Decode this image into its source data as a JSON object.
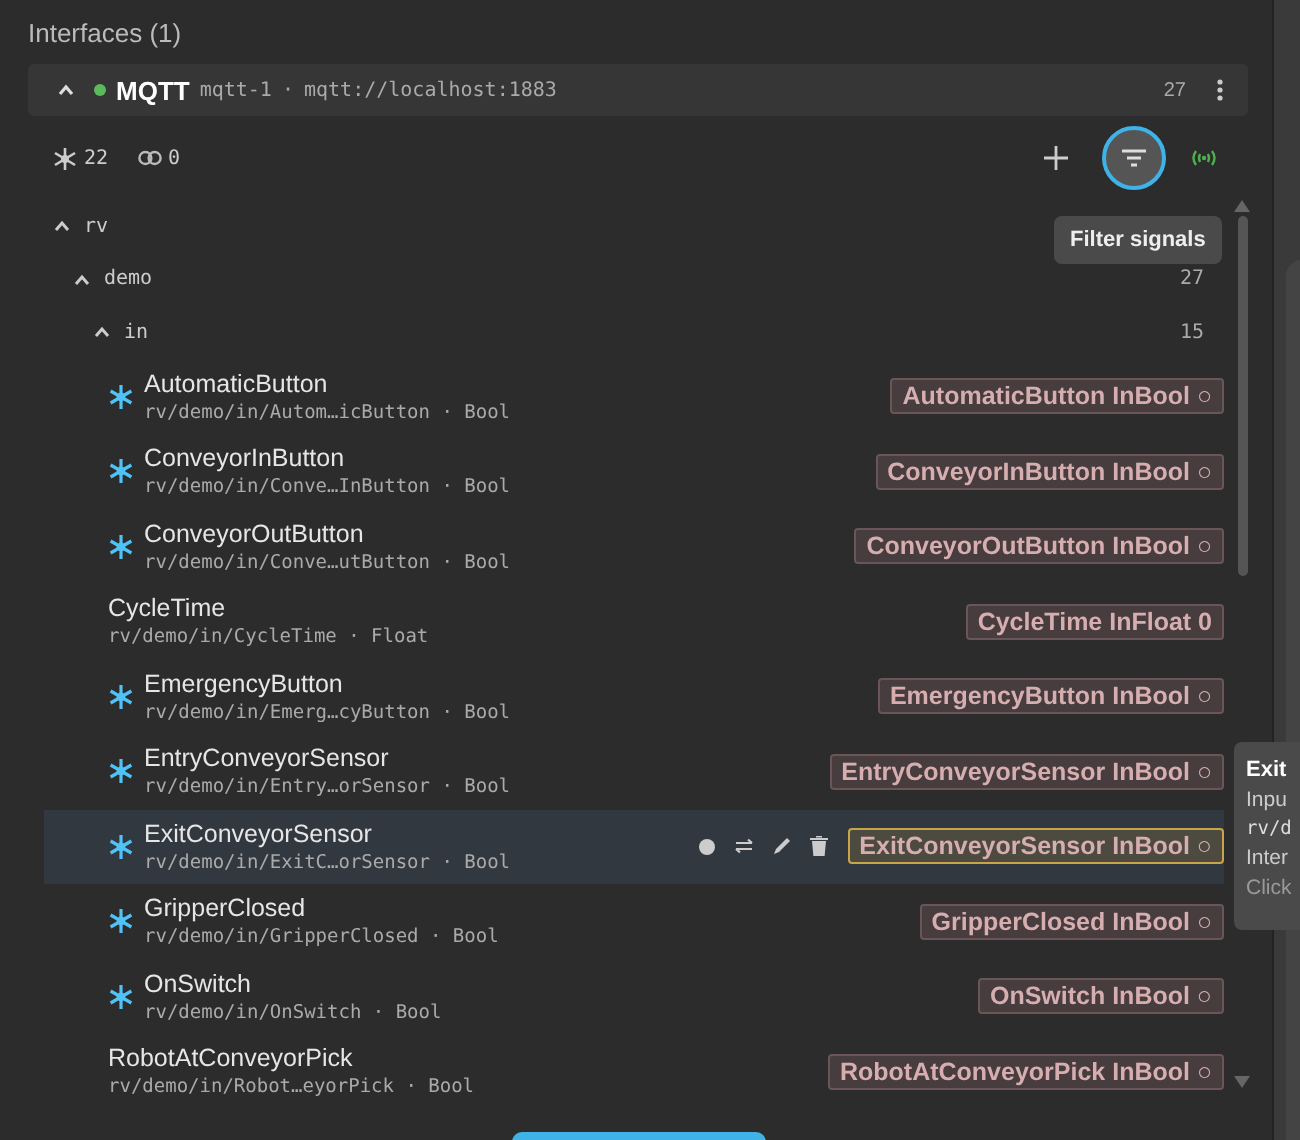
{
  "panel": {
    "title": "Interfaces (1)"
  },
  "interface": {
    "name": "MQTT",
    "connected": true,
    "id": "mqtt-1",
    "separator": "·",
    "url": "mqtt://localhost:1883",
    "count": "27",
    "expanded": true
  },
  "stats": {
    "signals": "22",
    "links": "0"
  },
  "toolbar": {
    "filter_active": true,
    "tooltip": "Filter signals"
  },
  "tree": [
    {
      "label": "rv",
      "expanded": true,
      "children": [
        {
          "label": "demo",
          "count": "27",
          "expanded": true,
          "children": [
            {
              "label": "in",
              "count": "15",
              "expanded": true
            }
          ]
        }
      ]
    }
  ],
  "signals": [
    {
      "name": "AutomaticButton",
      "path": "rv/demo/in/Autom…icButton",
      "separator": "·",
      "type": "Bool",
      "mapped": true,
      "selected": false,
      "chip": "AutomaticButton InBool",
      "value": "○"
    },
    {
      "name": "ConveyorInButton",
      "path": "rv/demo/in/Conve…InButton",
      "separator": "·",
      "type": "Bool",
      "mapped": true,
      "selected": false,
      "chip": "ConveyorInButton InBool",
      "value": "○"
    },
    {
      "name": "ConveyorOutButton",
      "path": "rv/demo/in/Conve…utButton",
      "separator": "·",
      "type": "Bool",
      "mapped": true,
      "selected": false,
      "chip": "ConveyorOutButton InBool",
      "value": "○"
    },
    {
      "name": "CycleTime",
      "path": "rv/demo/in/CycleTime",
      "separator": "·",
      "type": "Float",
      "mapped": false,
      "selected": false,
      "chip": "CycleTime InFloat",
      "value": "0"
    },
    {
      "name": "EmergencyButton",
      "path": "rv/demo/in/Emerg…cyButton",
      "separator": "·",
      "type": "Bool",
      "mapped": true,
      "selected": false,
      "chip": "EmergencyButton InBool",
      "value": "○"
    },
    {
      "name": "EntryConveyorSensor",
      "path": "rv/demo/in/Entry…orSensor",
      "separator": "·",
      "type": "Bool",
      "mapped": true,
      "selected": false,
      "chip": "EntryConveyorSensor InBool",
      "value": "○"
    },
    {
      "name": "ExitConveyorSensor",
      "path": "rv/demo/in/ExitC…orSensor",
      "separator": "·",
      "type": "Bool",
      "mapped": true,
      "selected": true,
      "chip": "ExitConveyorSensor InBool",
      "value": "○"
    },
    {
      "name": "GripperClosed",
      "path": "rv/demo/in/GripperClosed",
      "separator": "·",
      "type": "Bool",
      "mapped": true,
      "selected": false,
      "chip": "GripperClosed InBool",
      "value": "○"
    },
    {
      "name": "OnSwitch",
      "path": "rv/demo/in/OnSwitch",
      "separator": "·",
      "type": "Bool",
      "mapped": true,
      "selected": false,
      "chip": "OnSwitch InBool",
      "value": "○"
    },
    {
      "name": "RobotAtConveyorPick",
      "path": "rv/demo/in/Robot…eyorPick",
      "separator": "·",
      "type": "Bool",
      "mapped": false,
      "selected": false,
      "chip": "RobotAtConveyorPick InBool",
      "value": "○"
    }
  ],
  "side_tooltip": {
    "title": "Exit",
    "lines": [
      "Inpu",
      "rv/d",
      "Inter",
      "Click"
    ]
  }
}
